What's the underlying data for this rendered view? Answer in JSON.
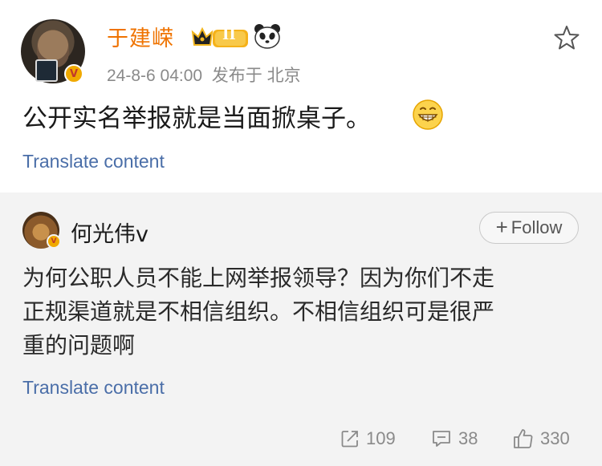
{
  "post": {
    "username": "于建嵘",
    "badge_text": "II",
    "date": "24-8-6 04:00",
    "location": "发布于 北京",
    "text": "公开实名举报就是当面掀桌子。",
    "translate_label": "Translate content",
    "username_color": "#ef7300"
  },
  "repost": {
    "username": "何光伟v",
    "follow_label": "Follow",
    "lines": [
      "为何公职人员不能上网举报领导？因为你们不走",
      "正规渠道就是不相信组织。不相信组织可是很严",
      "重的问题啊"
    ],
    "translate_label": "Translate content",
    "stats": {
      "reposts": "109",
      "comments": "38",
      "likes": "330"
    }
  },
  "colors": {
    "link": "#4a6ea8",
    "meta": "#8a8a8a",
    "repost_bg": "#f3f3f3"
  }
}
